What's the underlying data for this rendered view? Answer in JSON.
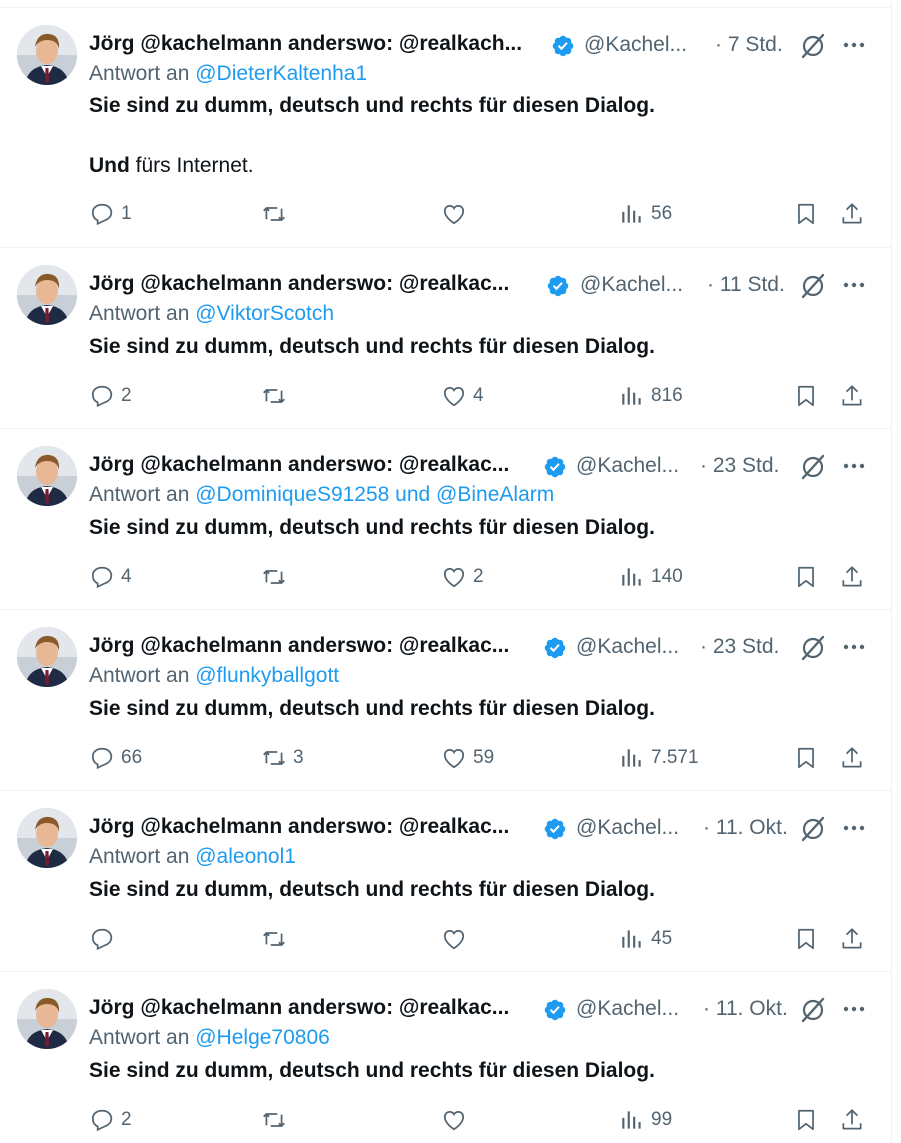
{
  "author": {
    "name": "Jörg @kachelmann anderswo: @realkach...",
    "handle": "@Kachel..."
  },
  "reply_prefix": "Antwort an",
  "tweets": [
    {
      "name": "Jörg @kachelmann anderswo: @realkach...",
      "handle": "@Kachel...",
      "time": "· 7 Std.",
      "reply_prefix": "Antwort an",
      "mention": "@DieterKaltenha1",
      "text": "Sie sind zu dumm, deutsch und rechts für diesen Dialog.",
      "text2_bold": "Und",
      "text2_rest": " fürs Internet.",
      "replies": "1",
      "retweets": "",
      "likes": "",
      "views": "56"
    },
    {
      "name": "Jörg @kachelmann anderswo: @realkac...",
      "handle": "@Kachel...",
      "time": "· 11 Std.",
      "reply_prefix": "Antwort an",
      "mention": "@ViktorScotch",
      "text": "Sie sind zu dumm, deutsch und rechts für diesen Dialog.",
      "replies": "2",
      "retweets": "",
      "likes": "4",
      "views": "816"
    },
    {
      "name": "Jörg @kachelmann anderswo: @realkac...",
      "handle": "@Kachel...",
      "time": "· 23 Std.",
      "reply_prefix": "Antwort an",
      "mention": "@DominiqueS91258 und @BineAlarm",
      "text": "Sie sind zu dumm, deutsch und rechts für diesen Dialog.",
      "replies": "4",
      "retweets": "",
      "likes": "2",
      "views": "140"
    },
    {
      "name": "Jörg @kachelmann anderswo: @realkac...",
      "handle": "@Kachel...",
      "time": "· 23 Std.",
      "reply_prefix": "Antwort an",
      "mention": "@flunkyballgott",
      "text": "Sie sind zu dumm, deutsch und rechts für diesen Dialog.",
      "replies": "66",
      "retweets": "3",
      "likes": "59",
      "views": "7.571"
    },
    {
      "name": "Jörg @kachelmann anderswo: @realkac...",
      "handle": "@Kachel...",
      "time": "· 11. Okt.",
      "reply_prefix": "Antwort an",
      "mention": "@aleonol1",
      "text": "Sie sind zu dumm, deutsch und rechts für diesen Dialog.",
      "replies": "",
      "retweets": "",
      "likes": "",
      "views": "45"
    },
    {
      "name": "Jörg @kachelmann anderswo: @realkac...",
      "handle": "@Kachel...",
      "time": "· 11. Okt.",
      "reply_prefix": "Antwort an",
      "mention": "@Helge70806",
      "text": "Sie sind zu dumm, deutsch und rechts für diesen Dialog.",
      "replies": "2",
      "retweets": "",
      "likes": "",
      "views": "99"
    }
  ],
  "colors": {
    "text": "#0f1419",
    "secondary": "#536471",
    "accent": "#1d9bf0",
    "divider": "#eff3f4"
  },
  "icons": [
    "verified-badge-icon",
    "grok-icon",
    "more-icon",
    "reply-icon",
    "retweet-icon",
    "like-icon",
    "views-icon",
    "bookmark-icon",
    "share-icon"
  ]
}
